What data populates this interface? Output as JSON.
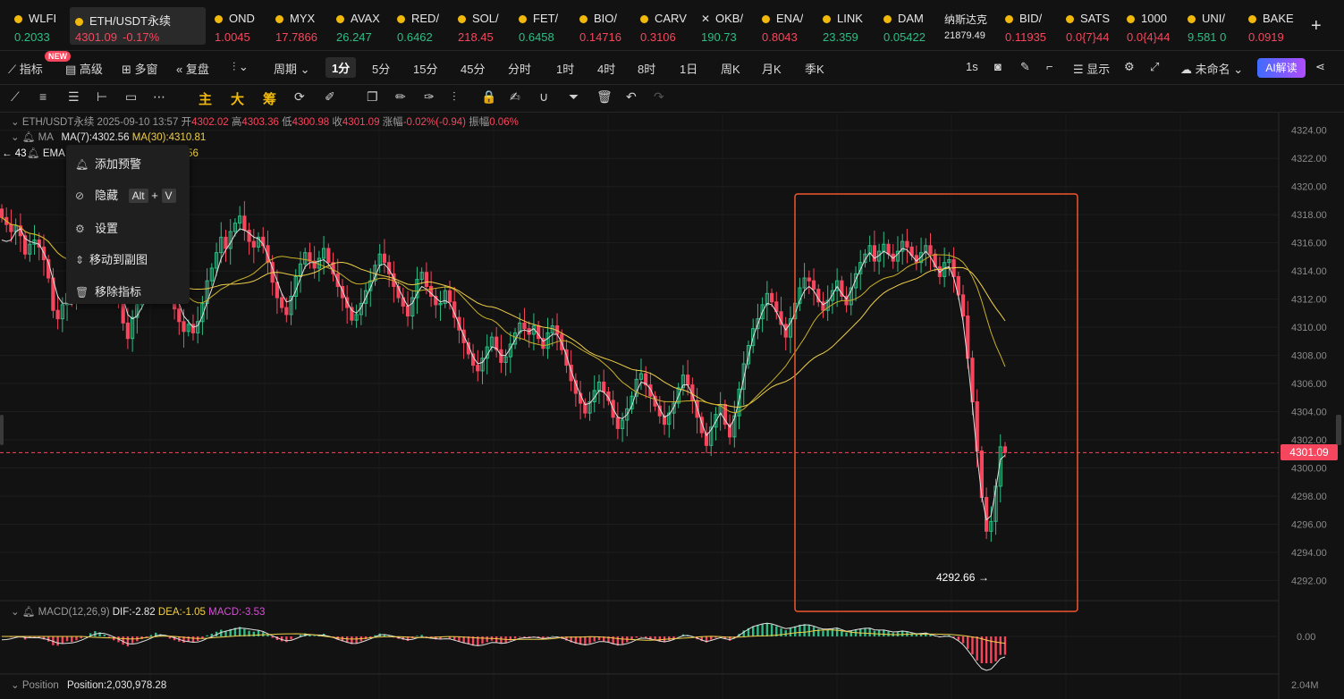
{
  "tickers": [
    {
      "symbol": "WLFI",
      "price": "0.2033",
      "dir": "up",
      "icon": "coin-icon"
    },
    {
      "symbol": "ETH/USDT永续",
      "price": "4301.09",
      "change": "-0.17%",
      "dir": "dn",
      "icon": "coin-icon",
      "active": true
    },
    {
      "symbol": "OND",
      "price": "1.0045",
      "dir": "dn",
      "icon": "coin-icon"
    },
    {
      "symbol": "MYX",
      "price": "17.7866",
      "dir": "dn",
      "icon": "coin-icon"
    },
    {
      "symbol": "AVAX",
      "price": "26.247",
      "dir": "up",
      "icon": "coin-icon"
    },
    {
      "symbol": "RED/",
      "price": "0.6462",
      "dir": "up",
      "icon": "coin-icon"
    },
    {
      "symbol": "SOL/",
      "price": "218.45",
      "dir": "dn",
      "icon": "coin-icon"
    },
    {
      "symbol": "FET/",
      "price": "0.6458",
      "dir": "up",
      "icon": "coin-icon"
    },
    {
      "symbol": "BIO/",
      "price": "0.14716",
      "dir": "dn",
      "icon": "coin-icon"
    },
    {
      "symbol": "CARV",
      "price": "0.3106",
      "dir": "dn",
      "icon": "coin-icon"
    },
    {
      "symbol": "OKB/",
      "price": "190.73",
      "dir": "up",
      "icon": "okb-icon"
    },
    {
      "symbol": "ENA/",
      "price": "0.8043",
      "dir": "dn",
      "icon": "coin-icon"
    },
    {
      "symbol": "LINK",
      "price": "23.359",
      "dir": "up",
      "icon": "coin-icon"
    },
    {
      "symbol": "DAM",
      "price": "0.05422",
      "dir": "up",
      "icon": "coin-icon"
    },
    {
      "symbol": "纳斯达克",
      "price": "21879.49",
      "dir": "neutral",
      "icon": "none"
    },
    {
      "symbol": "BID/",
      "price": "0.11935",
      "dir": "dn",
      "icon": "coin-icon"
    },
    {
      "symbol": "SATS",
      "price": "0.0{7}44",
      "dir": "dn",
      "icon": "coin-icon"
    },
    {
      "symbol": "1000",
      "price": "0.0{4}44",
      "dir": "dn",
      "icon": "coin-icon"
    },
    {
      "symbol": "UNI/",
      "price": "9.581 0",
      "dir": "up",
      "icon": "coin-icon"
    },
    {
      "symbol": "BAKE",
      "price": "0.0919",
      "dir": "dn",
      "icon": "coin-icon"
    }
  ],
  "toolbar": {
    "indicators": "指标",
    "new_badge": "NEW",
    "advanced": "高级",
    "multi_window": "多窗",
    "replay": "复盘",
    "period": "周期",
    "intervals": [
      "1分",
      "5分",
      "15分",
      "45分",
      "分时",
      "1时",
      "4时",
      "8时",
      "1日",
      "周K",
      "月K",
      "季K"
    ],
    "selected_interval": "1分",
    "refresh": "1s",
    "display": "显示",
    "unnamed": "未命名",
    "ai": "AI解读"
  },
  "drawtools": {
    "main": "主",
    "big": "大",
    "chip": "筹"
  },
  "info": {
    "symbol": "ETH/USDT永续",
    "time": "2025-09-10 13:57",
    "open_label": "开",
    "open": "4302.02",
    "high_label": "高",
    "high": "4303.36",
    "low_label": "低",
    "low": "4300.98",
    "close_label": "收",
    "close": "4301.09",
    "change_label": "涨幅",
    "change": "-0.02%(-0.94)",
    "amp_label": "振幅",
    "amp": "0.06%",
    "ma_label": "MA",
    "ma7": "MA(7):4302.56",
    "ma30": "MA(30):4310.81",
    "ema_label": "EMA",
    "ema_val": "):4308.56",
    "left_price": "43",
    "macd_label": "MACD(12,26,9)",
    "dif": "DIF:-2.82",
    "dea": "DEA:-1.05",
    "macd": "MACD:-3.53",
    "pos_label": "Position",
    "pos": "Position:2,030,978.28"
  },
  "context_menu": {
    "add_alert": "添加预警",
    "hide": "隐藏",
    "hide_key1": "Alt",
    "hide_plus": "+",
    "hide_key2": "V",
    "settings": "设置",
    "move": "移动到副图",
    "remove": "移除指标"
  },
  "colors": {
    "up": "#2ebd85",
    "down": "#f6465d",
    "ma7": "#e0e0e0",
    "ma30": "#f0d04a",
    "highlight": "#f2542d"
  },
  "chart_data": {
    "type": "candlestick",
    "y_axis_labels": [
      "4324.00",
      "4322.00",
      "4320.00",
      "4318.00",
      "4316.00",
      "4314.00",
      "4312.00",
      "4310.00",
      "4308.00",
      "4306.00",
      "4304.00",
      "4302.00",
      "4300.00",
      "4298.00",
      "4296.00",
      "4294.00",
      "4292.00"
    ],
    "ylim": [
      4291.2,
      4325
    ],
    "last_price": "4301.09",
    "min_label": "4292.66",
    "macd_axis_label": "0.00",
    "pos_axis_label": "2.04M",
    "candles_close": [
      4317.8,
      4317.3,
      4316.8,
      4317.2,
      4316.5,
      4315.2,
      4315.9,
      4316.2,
      4315.7,
      4314.8,
      4313.5,
      4311.2,
      4310.6,
      4311.6,
      4312.4,
      4311.8,
      4312.6,
      4313.5,
      4314.6,
      4316.2,
      4317.4,
      4316.9,
      4315.7,
      4314.4,
      4312.8,
      4311.7,
      4310.3,
      4309.2,
      4310.7,
      4311.6,
      4312.5,
      4313.2,
      4314.4,
      4315.5,
      4314.7,
      4313.6,
      4312.3,
      4311.3,
      4310.4,
      4309.7,
      4310.2,
      4309.6,
      4310.4,
      4311.7,
      4313.3,
      4314.2,
      4315.3,
      4316.4,
      4315.6,
      4316.8,
      4317.4,
      4317.9,
      4316.9,
      4316.1,
      4315.7,
      4316.4,
      4315.8,
      4314.6,
      4313.2,
      4312.1,
      4311.4,
      4310.9,
      4312.2,
      4313.6,
      4314.5,
      4315.3,
      4314.7,
      4314.2,
      4314.9,
      4315.6,
      4314.6,
      4313.8,
      4312.9,
      4312.1,
      4311.4,
      4310.5,
      4310.9,
      4311.7,
      4312.6,
      4313.3,
      4314.4,
      4315.2,
      4314.6,
      4313.8,
      4312.9,
      4312.1,
      4311.5,
      4310.8,
      4312.1,
      4313.4,
      4313.9,
      4312.9,
      4312.2,
      4311.6,
      4311.7,
      4312.6,
      4311.8,
      4310.7,
      4309.8,
      4308.9,
      4308.1,
      4307.3,
      4306.9,
      4307.8,
      4308.6,
      4309.3,
      4308.4,
      4307.5,
      4307.9,
      4308.8,
      4309.6,
      4310.3,
      4309.9,
      4309.5,
      4310.1,
      4309.2,
      4308.5,
      4309.6,
      4310.1,
      4309.5,
      4308.4,
      4307.3,
      4306.2,
      4305.3,
      4304.6,
      4303.9,
      4304.7,
      4305.5,
      4306.1,
      4305.4,
      4304.8,
      4303.6,
      4302.8,
      4303.4,
      4304.2,
      4305.1,
      4306.3,
      4306.7,
      4305.9,
      4305.1,
      4304.4,
      4303.7,
      4303.1,
      4303.9,
      4304.6,
      4305.7,
      4306.6,
      4305.9,
      4304.8,
      4303.6,
      4302.5,
      4301.6,
      4302.9,
      4303.8,
      4304.5,
      4303.1,
      4302.2,
      4303.7,
      4305.6,
      4307.4,
      4308.7,
      4309.9,
      4310.6,
      4311.6,
      4312.4,
      4311.8,
      4311.1,
      4310.2,
      4309.3,
      4310.6,
      4311.7,
      4312.8,
      4313.5,
      4313.3,
      4312.7,
      4311.8,
      4311.2,
      4311.9,
      4312.6,
      4313.3,
      4312.2,
      4311.6,
      4312.8,
      4313.8,
      4314.6,
      4315.2,
      4315.8,
      4314.7,
      4315.4,
      4315.9,
      4315.2,
      4314.7,
      4315.4,
      4316.1,
      4315.7,
      4315.1,
      4314.6,
      4315.3,
      4315.8,
      4315.2,
      4314.3,
      4313.6,
      4314.6,
      4314.8,
      4313.6,
      4312.3,
      4310.8,
      4307.8,
      4304.7,
      4301.2,
      4297.9,
      4295.5,
      4296.2,
      4298.7,
      4301.5,
      4301.1
    ],
    "ma7_line": [
      4316.2,
      4316.1,
      4316.2,
      4316.8,
      4317.0,
      4316.3,
      4316.1,
      4316.0,
      4315.9,
      4315.3,
      4314.6,
      4313.4,
      4312.2,
      4311.7,
      4311.7,
      4311.6,
      4312.0,
      4312.7,
      4313.6,
      4314.8,
      4315.8,
      4316.3,
      4316.2,
      4315.5,
      4314.5,
      4313.4,
      4312.1,
      4310.9,
      4310.6,
      4310.8,
      4311.4,
      4312.0,
      4312.9,
      4313.9,
      4314.3,
      4314.0,
      4313.4,
      4312.6,
      4311.7,
      4310.8,
      4310.4,
      4310.0,
      4310.1,
      4310.8,
      4311.8,
      4312.7,
      4313.8,
      4314.9,
      4315.5,
      4316.0,
      4316.6,
      4317.0,
      4316.9,
      4316.7,
      4316.4,
      4316.3,
      4315.9,
      4315.1,
      4314.2,
      4313.3,
      4312.4,
      4311.8,
      4311.9,
      4312.6,
      4313.5,
      4314.3,
      4314.6,
      4314.6,
      4314.7,
      4314.8,
      4314.5,
      4314.0,
      4313.3,
      4312.6,
      4311.8,
      4311.2,
      4311.0,
      4311.4,
      4312.1,
      4312.8,
      4313.6,
      4314.4,
      4314.5,
      4314.1,
      4313.5,
      4312.8,
      4312.1,
      4311.5,
      4311.7,
      4312.4,
      4312.9,
      4312.7,
      4312.4,
      4312.1,
      4311.8,
      4311.9,
      4311.7,
      4311.0,
      4310.2,
      4309.4,
      4308.7,
      4307.9,
      4307.4,
      4307.5,
      4308.0,
      4308.6,
      4308.5,
      4308.0,
      4308.0,
      4308.5,
      4309.1,
      4309.7,
      4309.8,
      4309.7,
      4309.9,
      4309.5,
      4309.0,
      4309.2,
      4309.5,
      4309.5,
      4308.9,
      4308.0,
      4306.9,
      4306.0,
      4305.2,
      4304.5,
      4304.6,
      4305.0,
      4305.5,
      4305.4,
      4305.0,
      4304.2,
      4303.6,
      4303.5,
      4303.8,
      4304.4,
      4305.4,
      4306.1,
      4306.0,
      4305.6,
      4304.9,
      4304.2,
      4303.6,
      4303.8,
      4304.3,
      4305.1,
      4305.9,
      4305.9,
      4305.2,
      4304.3,
      4303.2,
      4302.3,
      4302.7,
      4303.3,
      4303.9,
      4303.4,
      4302.9,
      4303.5,
      4304.8,
      4306.4,
      4307.9,
      4309.3,
      4310.2,
      4311.1,
      4311.7,
      4311.6,
      4311.1,
      4310.4,
      4309.8,
      4310.3,
      4311.0,
      4311.9,
      4312.6,
      4312.9,
      4312.6,
      4312.0,
      4311.6,
      4311.8,
      4312.3,
      4312.9,
      4312.4,
      4312.0,
      4312.6,
      4313.4,
      4314.1,
      4314.8,
      4315.3,
      4314.9,
      4315.1,
      4315.4,
      4315.2,
      4314.9,
      4315.2,
      4315.6,
      4315.5,
      4315.1,
      4314.7,
      4315.0,
      4315.4,
      4315.0,
      4314.4,
      4313.9,
      4314.2,
      4314.3,
      4313.5,
      4312.2,
      4310.4,
      4307.6,
      4304.4,
      4300.9,
      4298.0,
      4296.3,
      4296.6,
      4298.5,
      4300.6,
      4300.9
    ]
  }
}
